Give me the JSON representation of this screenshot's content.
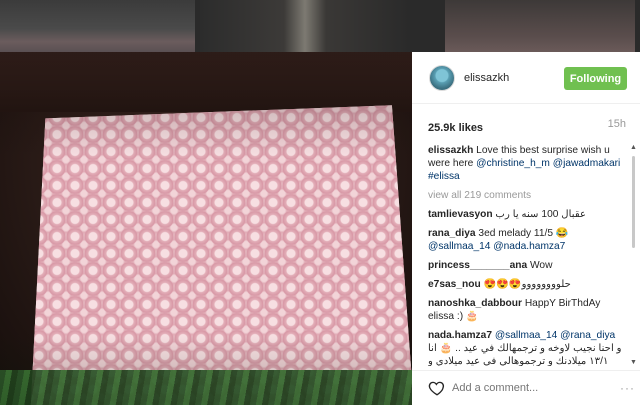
{
  "post": {
    "username": "elissazkh",
    "follow_label": "Following",
    "likes": "25.9k likes",
    "time": "15h",
    "caption": {
      "username": "elissazkh",
      "text": "Love this best surprise wish u were here",
      "mention1": "@christine_h_m",
      "mention2": "@jawadmakari",
      "hashtag": "#elissa"
    },
    "view_all": "view all 219 comments",
    "add_comment_placeholder": "Add a comment...",
    "more_label": "···"
  },
  "comments": [
    {
      "user": "tamlievasyon",
      "text": "عقبال 100 سنه يا رب"
    },
    {
      "user": "rana_diya",
      "text": "3ed melady 11/5 😂",
      "mentions": "@sallmaa_14 @nada.hamza7"
    },
    {
      "user": "princess_______ana",
      "text": "Wow"
    },
    {
      "user": "e7sas_nou",
      "text": "😍😍😍حلوووووووو"
    },
    {
      "user": "nanoshka_dabbour",
      "text": "HappY BirThdAy elissa :) 🎂"
    },
    {
      "user": "nada.hamza7",
      "mention1": "@sallmaa_14",
      "mention2": "@rana_diya",
      "text": "و احنا نجيب لاوخه و ترجمهالك في عيد .. 🎂 انا ١٣/١ ميلادنك و ترجموهالي في عيد ميلادي و جمعية و دايرة 😘بابا"
    }
  ],
  "icons": {
    "heart": "heart-outline-icon",
    "avatar": "profile-avatar",
    "scroll_up": "scroll-up-arrow-icon",
    "scroll_down": "scroll-down-arrow-icon"
  },
  "colors": {
    "follow_button": "#70c050",
    "link": "#003569",
    "muted": "#999999"
  }
}
